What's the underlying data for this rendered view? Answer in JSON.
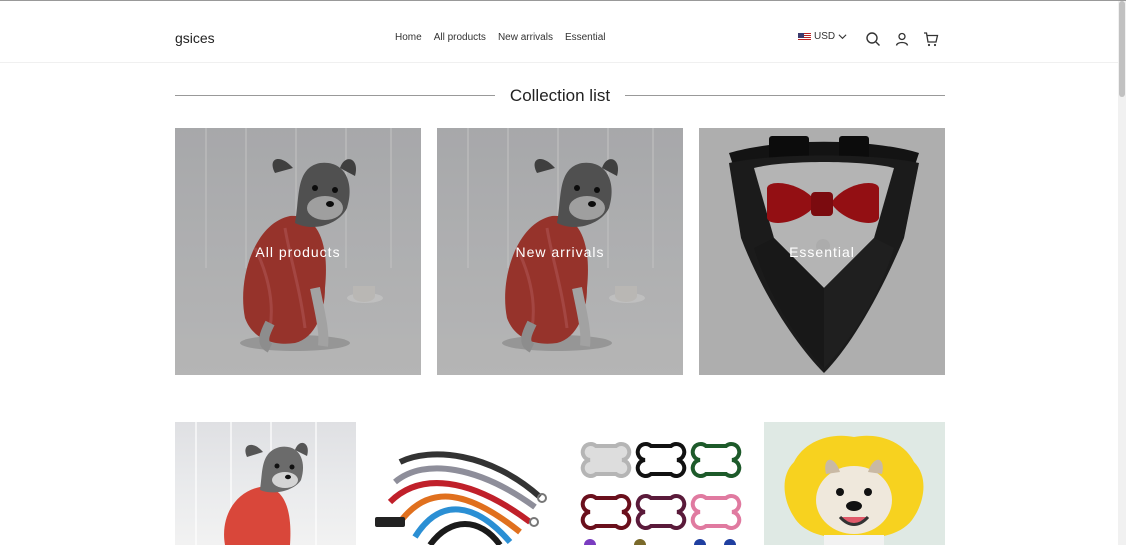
{
  "header": {
    "logo": "gsices",
    "nav": [
      "Home",
      "All products",
      "New arrivals",
      "Essential"
    ],
    "currency": "USD",
    "icons": [
      "search-icon",
      "account-icon",
      "cart-icon"
    ]
  },
  "collection": {
    "title": "Collection list",
    "items": [
      {
        "label": "All products",
        "image": "dog-in-red-sweater"
      },
      {
        "label": "New arrivals",
        "image": "dog-in-red-sweater"
      },
      {
        "label": "Essential",
        "image": "pet-bandana-bow-tie"
      }
    ]
  },
  "products": [
    {
      "image": "dog-in-red-sweater"
    },
    {
      "image": "bungee-dog-leashes"
    },
    {
      "image": "bone-shaped-id-tags"
    },
    {
      "image": "dog-in-yellow-flower-cone"
    }
  ],
  "colors": {
    "overlay": "#00000040",
    "text": "#222222",
    "divider": "#999999"
  }
}
